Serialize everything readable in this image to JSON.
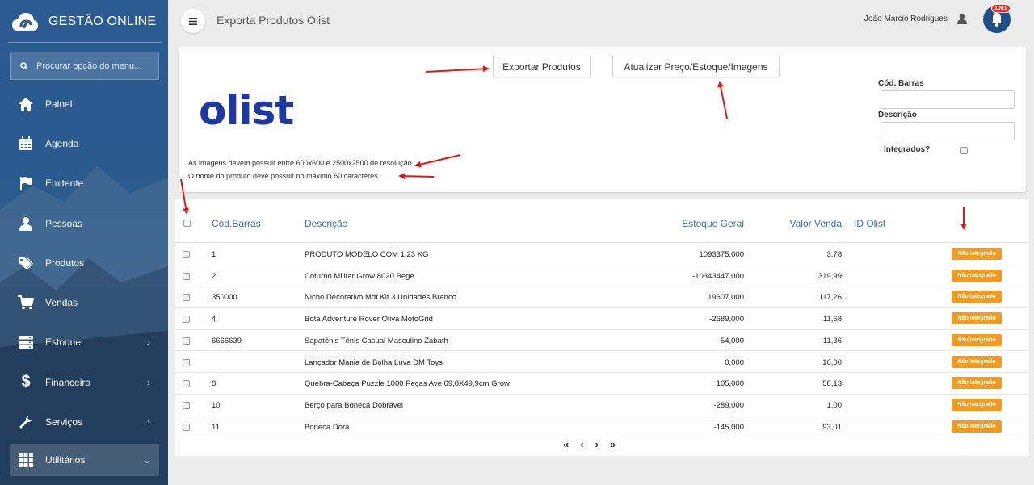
{
  "colors": {
    "sidebar": "#2b5b93",
    "accent": "#3c6ea5",
    "badge": "#f29b1f",
    "notification": "#d9342b",
    "olist": "#1c37a6",
    "arrow": "#e01818"
  },
  "app": {
    "name": "GESTÃO ONLINE",
    "page_title": "Exporta Produtos Olist"
  },
  "menu_search": {
    "placeholder": "Procurar opção do menu..."
  },
  "sidebar": {
    "items": [
      {
        "label": "Painel",
        "icon": "home-icon",
        "has_children": false
      },
      {
        "label": "Agenda",
        "icon": "calendar-icon",
        "has_children": false
      },
      {
        "label": "Emitente",
        "icon": "flag-icon",
        "has_children": false
      },
      {
        "label": "Pessoas",
        "icon": "user-icon",
        "has_children": false
      },
      {
        "label": "Produtos",
        "icon": "tags-icon",
        "has_children": false
      },
      {
        "label": "Vendas",
        "icon": "cart-icon",
        "has_children": false
      },
      {
        "label": "Estoque",
        "icon": "server-icon",
        "has_children": true
      },
      {
        "label": "Financeiro",
        "icon": "dollar-icon",
        "has_children": true
      },
      {
        "label": "Serviços",
        "icon": "wrench-icon",
        "has_children": true
      },
      {
        "label": "Utilitários",
        "icon": "grid-icon",
        "has_children": true
      }
    ]
  },
  "header": {
    "user_name": "João Marcio Rodrigues",
    "notifications": "1001"
  },
  "panel": {
    "export_button": "Exportar Produtos",
    "update_button": "Atualizar Preço/Estoque/Imagens",
    "logo_text": "olist",
    "note_images": "As imagens devem possuir entre 600x600 e 2500x2500 de resolução.",
    "note_name": "O nome do produto deve possuir no máximo 60 caracteres.",
    "filters": {
      "barcode_label": "Cód. Barras",
      "description_label": "Descrição",
      "integrated_label": "Integrados?",
      "barcode_value": "",
      "description_value": ""
    }
  },
  "table": {
    "columns": {
      "barcode": "Cód.Barras",
      "description": "Descrição",
      "stock": "Estoque Geral",
      "price": "Valor Venda",
      "olist_id": "ID Olist"
    },
    "rows": [
      {
        "barcode": "1",
        "description": "PRODUTO MODELO COM 1,23 KG",
        "stock": "1093375,000",
        "price": "3,78",
        "olist_id": "",
        "status": "Não Integrado"
      },
      {
        "barcode": "2",
        "description": "Coturno Militar Grow 8020 Bege",
        "stock": "-10343447,000",
        "price": "319,99",
        "olist_id": "",
        "status": "Não Integrado"
      },
      {
        "barcode": "350000",
        "description": "Nicho Decorativo Mdf Kit 3 Unidades Branco",
        "stock": "19607,000",
        "price": "117,26",
        "olist_id": "",
        "status": "Não Integrado"
      },
      {
        "barcode": "4",
        "description": "Bota Adventure Rover Oliva MotoGrid",
        "stock": "-2689,000",
        "price": "11,68",
        "olist_id": "",
        "status": "Não Integrado"
      },
      {
        "barcode": "6666639",
        "description": "Sapatênis Tênis Casual Masculino Zabath",
        "stock": "-54,000",
        "price": "11,36",
        "olist_id": "",
        "status": "Não Integrado"
      },
      {
        "barcode": "",
        "description": "Lançador Mania de Bolha Luva DM Toys",
        "stock": "0,000",
        "price": "16,00",
        "olist_id": "",
        "status": "Não Integrado"
      },
      {
        "barcode": "8",
        "description": "Quebra-Cabeça Puzzle 1000 Peças Ave 69,8X49,9cm Grow",
        "stock": "105,000",
        "price": "58,13",
        "olist_id": "",
        "status": "Não Integrado"
      },
      {
        "barcode": "10",
        "description": "Berço para Boneca Dobrável",
        "stock": "-289,000",
        "price": "1,00",
        "olist_id": "",
        "status": "Não Integrado"
      },
      {
        "barcode": "11",
        "description": "Boneca Dora",
        "stock": "-145,000",
        "price": "93,01",
        "olist_id": "",
        "status": "Não Integrado"
      }
    ]
  },
  "pagination": {
    "first": "«",
    "prev": "‹",
    "next": "›",
    "last": "»"
  }
}
